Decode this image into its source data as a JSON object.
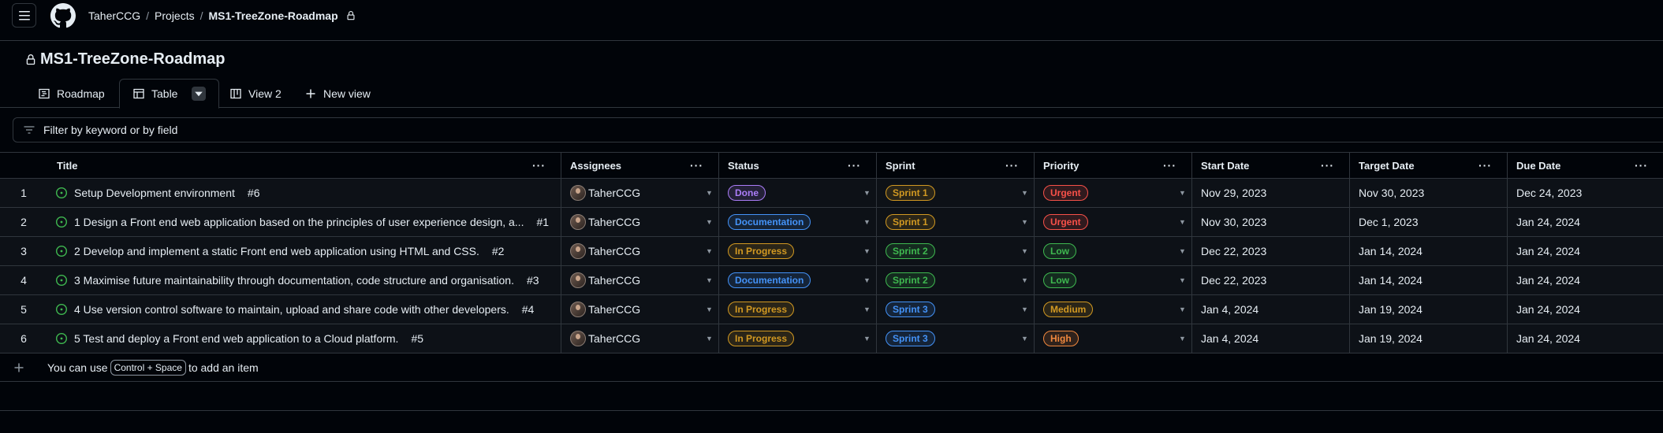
{
  "header": {
    "owner": "TaherCCG",
    "projects": "Projects",
    "project": "MS1-TreeZone-Roadmap"
  },
  "page_title": "MS1-TreeZone-Roadmap",
  "views": [
    {
      "label": "Roadmap",
      "icon": "roadmap-icon"
    },
    {
      "label": "Table",
      "icon": "table-icon"
    },
    {
      "label": "View 2",
      "icon": "board-icon"
    },
    {
      "label": "New view",
      "icon": "plus-icon"
    }
  ],
  "filter": {
    "placeholder": "Filter by keyword or by field"
  },
  "columns": [
    "Title",
    "Assignees",
    "Status",
    "Sprint",
    "Priority",
    "Start Date",
    "Target Date",
    "Due Date"
  ],
  "rows": [
    {
      "n": "1",
      "title": "Setup Development environment",
      "issue": "#6",
      "assignee": "TaherCCG",
      "status": "Done",
      "sprint": "Sprint 1",
      "priority": "Urgent",
      "start": "Nov 29, 2023",
      "target": "Nov 30, 2023",
      "due": "Dec 24, 2023"
    },
    {
      "n": "2",
      "title": "1 Design a Front end web application based on the principles of user experience design, a...",
      "issue": "#1",
      "assignee": "TaherCCG",
      "status": "Documentation",
      "sprint": "Sprint 1",
      "priority": "Urgent",
      "start": "Nov 30, 2023",
      "target": "Dec 1, 2023",
      "due": "Jan 24, 2024"
    },
    {
      "n": "3",
      "title": "2 Develop and implement a static Front end web application using HTML and CSS.",
      "issue": "#2",
      "assignee": "TaherCCG",
      "status": "In Progress",
      "sprint": "Sprint 2",
      "priority": "Low",
      "start": "Dec 22, 2023",
      "target": "Jan 14, 2024",
      "due": "Jan 24, 2024"
    },
    {
      "n": "4",
      "title": "3 Maximise future maintainability through documentation, code structure and organisation.",
      "issue": "#3",
      "assignee": "TaherCCG",
      "status": "Documentation",
      "sprint": "Sprint 2",
      "priority": "Low",
      "start": "Dec 22, 2023",
      "target": "Jan 14, 2024",
      "due": "Jan 24, 2024"
    },
    {
      "n": "5",
      "title": "4 Use version control software to maintain, upload and share code with other developers.",
      "issue": "#4",
      "assignee": "TaherCCG",
      "status": "In Progress",
      "sprint": "Sprint 3",
      "priority": "Medium",
      "start": "Jan 4, 2024",
      "target": "Jan 19, 2024",
      "due": "Jan 24, 2024"
    },
    {
      "n": "6",
      "title": "5 Test and deploy a Front end web application to a Cloud platform.",
      "issue": "#5",
      "assignee": "TaherCCG",
      "status": "In Progress",
      "sprint": "Sprint 3",
      "priority": "High",
      "start": "Jan 4, 2024",
      "target": "Jan 19, 2024",
      "due": "Jan 24, 2024"
    }
  ],
  "add_item": {
    "prefix": "You can use",
    "shortcut": "Control + Space",
    "suffix": "to add an item"
  },
  "colors": {
    "Done": "#ab7df8",
    "Documentation": "#4493f8",
    "In Progress": "#d29922",
    "Sprint 1": "#d29922",
    "Sprint 2": "#3fb950",
    "Sprint 3": "#4493f8",
    "Urgent": "#f85149",
    "Low": "#3fb950",
    "Medium": "#d29922",
    "High": "#f0883e",
    "open_issue": "#3fb950"
  }
}
